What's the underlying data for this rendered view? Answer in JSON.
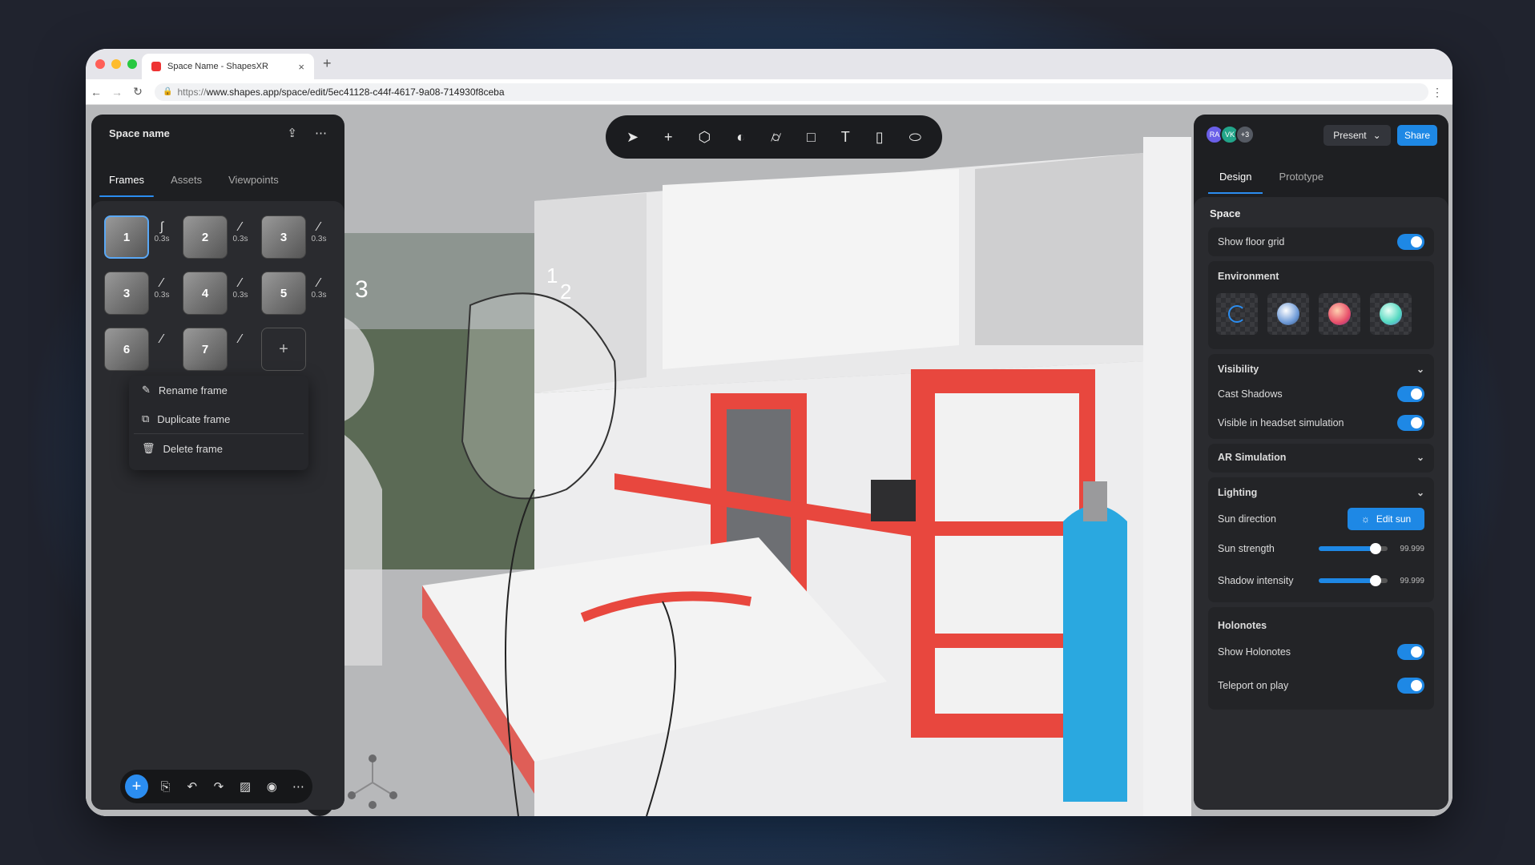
{
  "browser": {
    "tab_title": "Space Name - ShapesXR",
    "new_tab": "+",
    "tab_close": "×",
    "url_prefix": "https://",
    "url_rest": "www.shapes.app/space/edit/5ec41128-c44f-4617-9a08-714930f8ceba"
  },
  "colors": {
    "accent": "#1e88e5",
    "scene_red": "#e8473e",
    "tank": "#2aa8e0"
  },
  "left_panel": {
    "title": "Space name",
    "tabs": [
      "Frames",
      "Assets",
      "Viewpoints"
    ],
    "frames": [
      {
        "label": "1",
        "transition": "0.3s",
        "curve": "ease-icon"
      },
      {
        "label": "2",
        "transition": "0.3s",
        "curve": "linear-icon"
      },
      {
        "label": "3",
        "transition": "0.3s",
        "curve": "linear-icon"
      },
      {
        "label": "3",
        "transition": "0.3s",
        "curve": "linear-icon"
      },
      {
        "label": "4",
        "transition": "0.3s",
        "curve": "linear-icon"
      },
      {
        "label": "5",
        "transition": "0.3s",
        "curve": "linear-icon"
      },
      {
        "label": "6",
        "transition": "",
        "curve": "linear-icon"
      },
      {
        "label": "7",
        "transition": "",
        "curve": "linear-icon"
      }
    ],
    "context_menu": [
      "Rename frame",
      "Duplicate frame",
      "Delete frame"
    ]
  },
  "scene": {
    "labels": [
      "3",
      "1",
      "2"
    ]
  },
  "right_panel": {
    "avatars": [
      {
        "text": "RA",
        "color": "#6a5fe8"
      },
      {
        "text": "VK",
        "color": "#22a58a"
      },
      {
        "text": "+3",
        "color": "#555a63"
      }
    ],
    "present": "Present",
    "share": "Share",
    "tabs": [
      "Design",
      "Prototype"
    ],
    "space_title": "Space",
    "show_floor_grid": {
      "label": "Show floor grid",
      "on": true
    },
    "environment": {
      "title": "Environment"
    },
    "visibility": {
      "title": "Visibility",
      "cast_shadows": "Cast Shadows",
      "visible_headset": "Visible in headset simulation"
    },
    "ar_simulation": "AR Simulation",
    "lighting": {
      "title": "Lighting",
      "sun_direction": "Sun direction",
      "edit_sun": "Edit sun",
      "sun_strength": "Sun strength",
      "sun_strength_value": "99.999",
      "shadow_intensity": "Shadow intensity",
      "shadow_intensity_value": "99.999"
    },
    "holonotes": {
      "title": "Holonotes",
      "show": "Show Holonotes",
      "teleport": "Teleport on play"
    }
  }
}
